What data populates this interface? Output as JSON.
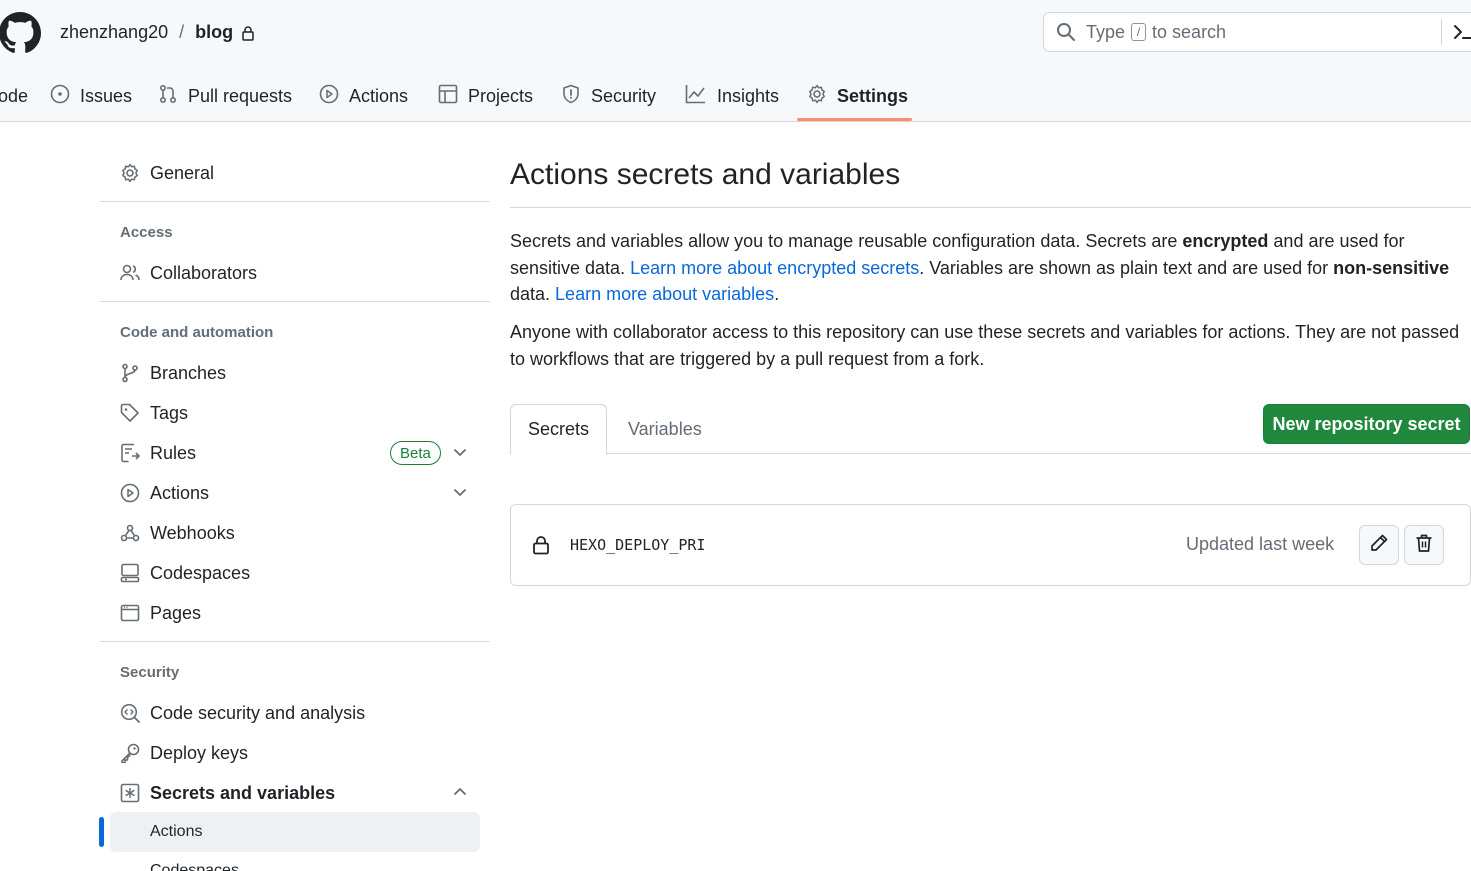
{
  "header": {
    "owner": "zhenzhang20",
    "separator": "/",
    "repo": "blog",
    "search": {
      "prefix": "Type",
      "key": "/",
      "suffix": "to search"
    }
  },
  "repo_tabs": [
    {
      "label": "ode",
      "icon": "code-icon"
    },
    {
      "label": "Issues",
      "icon": "issue-icon"
    },
    {
      "label": "Pull requests",
      "icon": "pull-request-icon"
    },
    {
      "label": "Actions",
      "icon": "play-icon"
    },
    {
      "label": "Projects",
      "icon": "table-icon"
    },
    {
      "label": "Security",
      "icon": "shield-icon"
    },
    {
      "label": "Insights",
      "icon": "graph-icon"
    },
    {
      "label": "Settings",
      "icon": "gear-icon",
      "selected": true
    }
  ],
  "sidebar": {
    "general": "General",
    "sections": {
      "access": "Access",
      "code_automation": "Code and automation",
      "security": "Security"
    },
    "items": {
      "collaborators": "Collaborators",
      "branches": "Branches",
      "tags": "Tags",
      "rules": "Rules",
      "rules_badge": "Beta",
      "actions": "Actions",
      "webhooks": "Webhooks",
      "codespaces": "Codespaces",
      "pages": "Pages",
      "code_security": "Code security and analysis",
      "deploy_keys": "Deploy keys",
      "secrets_variables": "Secrets and variables",
      "sub_actions": "Actions",
      "sub_codespaces": "Codespaces"
    }
  },
  "main": {
    "title": "Actions secrets and variables",
    "p1": {
      "t1": "Secrets and variables allow you to manage reusable configuration data. Secrets are ",
      "b1": "encrypted",
      "t2": " and are used for sensitive data. ",
      "link1": "Learn more about encrypted secrets",
      "t3": ". Variables are shown as plain text and are used for ",
      "b2": "non-sensitive",
      "t4": " data. ",
      "link2": "Learn more about variables",
      "t5": "."
    },
    "p2": "Anyone with collaborator access to this repository can use these secrets and variables for actions. They are not passed to workflows that are triggered by a pull request from a fork.",
    "tabs": {
      "secrets": "Secrets",
      "variables": "Variables"
    },
    "new_button": "New repository secret",
    "secret": {
      "name": "HEXO_DEPLOY_PRI",
      "updated": "Updated last week"
    }
  },
  "colors": {
    "primary_button": "#1f883d",
    "link": "#0969da",
    "tab_underline": "#fd8c73",
    "active_indicator": "#0969da"
  }
}
